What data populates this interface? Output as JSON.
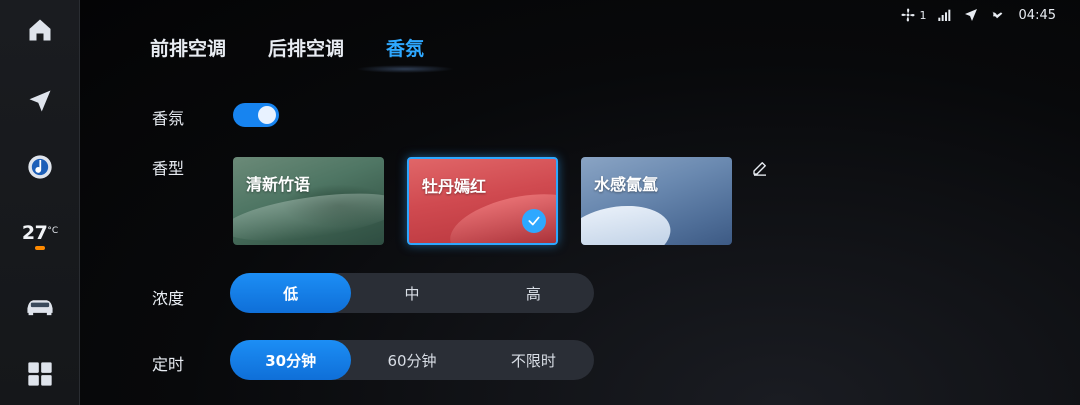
{
  "status_bar": {
    "fan_level": "1",
    "time": "04:45"
  },
  "rail": {
    "temperature": "27",
    "temperature_unit": "°C"
  },
  "tabs": [
    {
      "label": "前排空调",
      "active": false
    },
    {
      "label": "后排空调",
      "active": false
    },
    {
      "label": "香氛",
      "active": true
    }
  ],
  "fragrance": {
    "toggle_label": "香氛",
    "enabled": true,
    "type_label": "香型",
    "scents": [
      {
        "label": "清新竹语",
        "selected": false
      },
      {
        "label": "牡丹嫣红",
        "selected": true
      },
      {
        "label": "水感氤氲",
        "selected": false
      }
    ],
    "concentration_label": "浓度",
    "concentration_options": [
      "低",
      "中",
      "高"
    ],
    "concentration_selected": "低",
    "timer_label": "定时",
    "timer_options": [
      "30分钟",
      "60分钟",
      "不限时"
    ],
    "timer_selected": "30分钟"
  },
  "colors": {
    "accent": "#1784f0",
    "highlight": "#2ea8ff",
    "temp_indicator": "#ff8a00"
  }
}
